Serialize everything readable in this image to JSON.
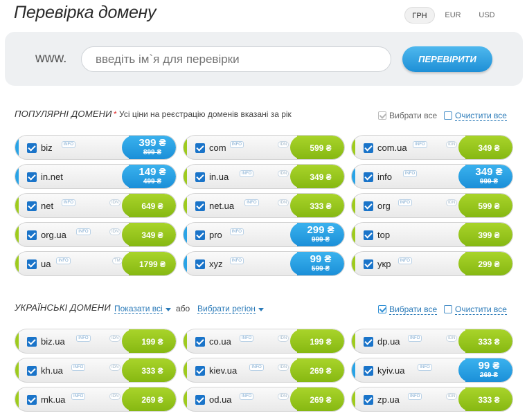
{
  "header": {
    "title": "Перевірка домену",
    "currencies": [
      "ГРН",
      "EUR",
      "USD"
    ]
  },
  "search": {
    "prefix": "www.",
    "placeholder": "введіть ім`я для перевірки",
    "button": "ПЕРЕВІРИТИ"
  },
  "popular": {
    "title": "ПОПУЛЯРНІ ДОМЕНИ",
    "note_star": "*",
    "note": "Усі ціни на реєстрацію доменів вказані за рік",
    "select_all": "Вибрати все",
    "clear_all": "Очистити все",
    "domains": [
      {
        "name": "biz",
        "info": "INFO",
        "idn": "",
        "price": "399 ₴",
        "old": "899 ₴",
        "promo": true
      },
      {
        "name": "com",
        "info": "INFO",
        "idn": "IDN",
        "price": "599 ₴",
        "old": "",
        "promo": false
      },
      {
        "name": "com.ua",
        "info": "INFO",
        "idn": "IDN",
        "price": "349 ₴",
        "old": "",
        "promo": false
      },
      {
        "name": "in.net",
        "info": "",
        "idn": "",
        "price": "149 ₴",
        "old": "499 ₴",
        "promo": true
      },
      {
        "name": "in.ua",
        "info": "INFO",
        "idn": "IDN",
        "price": "349 ₴",
        "old": "",
        "promo": false
      },
      {
        "name": "info",
        "info": "INFO",
        "idn": "",
        "price": "349 ₴",
        "old": "999 ₴",
        "promo": true
      },
      {
        "name": "net",
        "info": "INFO",
        "idn": "IDN",
        "price": "649 ₴",
        "old": "",
        "promo": false
      },
      {
        "name": "net.ua",
        "info": "INFO",
        "idn": "IDN",
        "price": "333 ₴",
        "old": "",
        "promo": false
      },
      {
        "name": "org",
        "info": "INFO",
        "idn": "IDN",
        "price": "599 ₴",
        "old": "",
        "promo": false
      },
      {
        "name": "org.ua",
        "info": "INFO",
        "idn": "IDN",
        "price": "349 ₴",
        "old": "",
        "promo": false
      },
      {
        "name": "pro",
        "info": "INFO",
        "idn": "",
        "price": "299 ₴",
        "old": "999 ₴",
        "promo": true
      },
      {
        "name": "top",
        "info": "",
        "idn": "",
        "price": "399 ₴",
        "old": "",
        "promo": false
      },
      {
        "name": "ua",
        "info": "INFO",
        "idn": "TM",
        "price": "1799 ₴",
        "old": "",
        "promo": false
      },
      {
        "name": "xyz",
        "info": "INFO",
        "idn": "",
        "price": "99 ₴",
        "old": "599 ₴",
        "promo": true
      },
      {
        "name": "укр",
        "info": "INFO",
        "idn": "",
        "price": "299 ₴",
        "old": "",
        "promo": false
      }
    ]
  },
  "ukrainian": {
    "title": "УКРАЇНСЬКІ ДОМЕНИ",
    "show_all": "Показати всі",
    "or": "або",
    "choose_region": "Вибрати регіон",
    "select_all": "Вибрати все",
    "clear_all": "Очистити все",
    "domains": [
      {
        "name": "biz.ua",
        "info": "INFO",
        "idn": "IDN",
        "price": "199 ₴",
        "old": "",
        "promo": false
      },
      {
        "name": "co.ua",
        "info": "INFO",
        "idn": "IDN",
        "price": "199 ₴",
        "old": "",
        "promo": false
      },
      {
        "name": "dp.ua",
        "info": "INFO",
        "idn": "IDN",
        "price": "333 ₴",
        "old": "",
        "promo": false
      },
      {
        "name": "kh.ua",
        "info": "INFO",
        "idn": "IDN",
        "price": "333 ₴",
        "old": "",
        "promo": false
      },
      {
        "name": "kiev.ua",
        "info": "INFO",
        "idn": "IDN",
        "price": "269 ₴",
        "old": "",
        "promo": false
      },
      {
        "name": "kyiv.ua",
        "info": "INFO",
        "idn": "",
        "price": "99 ₴",
        "old": "269 ₴",
        "promo": true
      },
      {
        "name": "mk.ua",
        "info": "INFO",
        "idn": "IDN",
        "price": "269 ₴",
        "old": "",
        "promo": false
      },
      {
        "name": "od.ua",
        "info": "INFO",
        "idn": "IDN",
        "price": "269 ₴",
        "old": "",
        "promo": false
      },
      {
        "name": "zp.ua",
        "info": "INFO",
        "idn": "IDN",
        "price": "333 ₴",
        "old": "",
        "promo": false
      }
    ]
  },
  "colors": {
    "green": "#9ecb1d",
    "blue": "#29a3e6",
    "link": "#2a7ab8"
  }
}
